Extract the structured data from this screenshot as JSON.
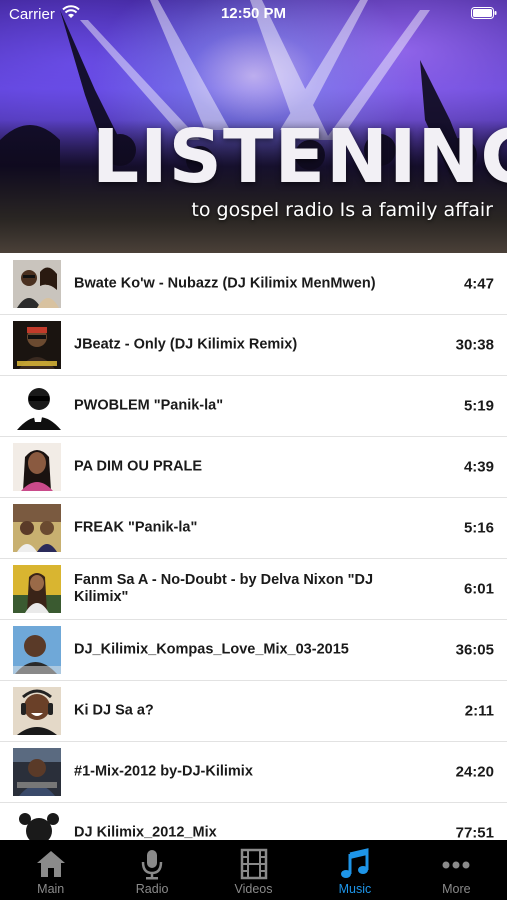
{
  "status_bar": {
    "carrier": "Carrier",
    "time": "12:50 PM"
  },
  "banner": {
    "title": "LISTENING",
    "subtitle": "to gospel radio Is a family affair"
  },
  "tracks": [
    {
      "title": "Bwate Ko'w - Nubazz (DJ Kilimix MenMwen)",
      "duration": "4:47"
    },
    {
      "title": "JBeatz - Only (DJ Kilimix Remix)",
      "duration": "30:38"
    },
    {
      "title": "PWOBLEM \"Panik-la\"",
      "duration": "5:19"
    },
    {
      "title": "PA DIM OU PRALE",
      "duration": "4:39"
    },
    {
      "title": "FREAK \"Panik-la\"",
      "duration": "5:16"
    },
    {
      "title": "Fanm Sa A - No-Doubt - by Delva Nixon \"DJ Kilimix\"",
      "duration": "6:01"
    },
    {
      "title": "DJ_Kilimix_Kompas_Love_Mix_03-2015",
      "duration": "36:05"
    },
    {
      "title": "Ki DJ Sa a?",
      "duration": "2:11"
    },
    {
      "title": "#1-Mix-2012 by-DJ-Kilimix",
      "duration": "24:20"
    },
    {
      "title": "DJ Kilimix_2012_Mix",
      "duration": "77:51"
    }
  ],
  "tabs": [
    {
      "label": "Main",
      "icon": "home-icon"
    },
    {
      "label": "Radio",
      "icon": "microphone-icon"
    },
    {
      "label": "Videos",
      "icon": "film-icon"
    },
    {
      "label": "Music",
      "icon": "music-note-icon",
      "active": true
    },
    {
      "label": "More",
      "icon": "more-icon"
    }
  ],
  "colors": {
    "active_tab": "#1e95e8",
    "inactive_tab": "#8a8a8a",
    "tab_bar_bg": "#000000"
  }
}
